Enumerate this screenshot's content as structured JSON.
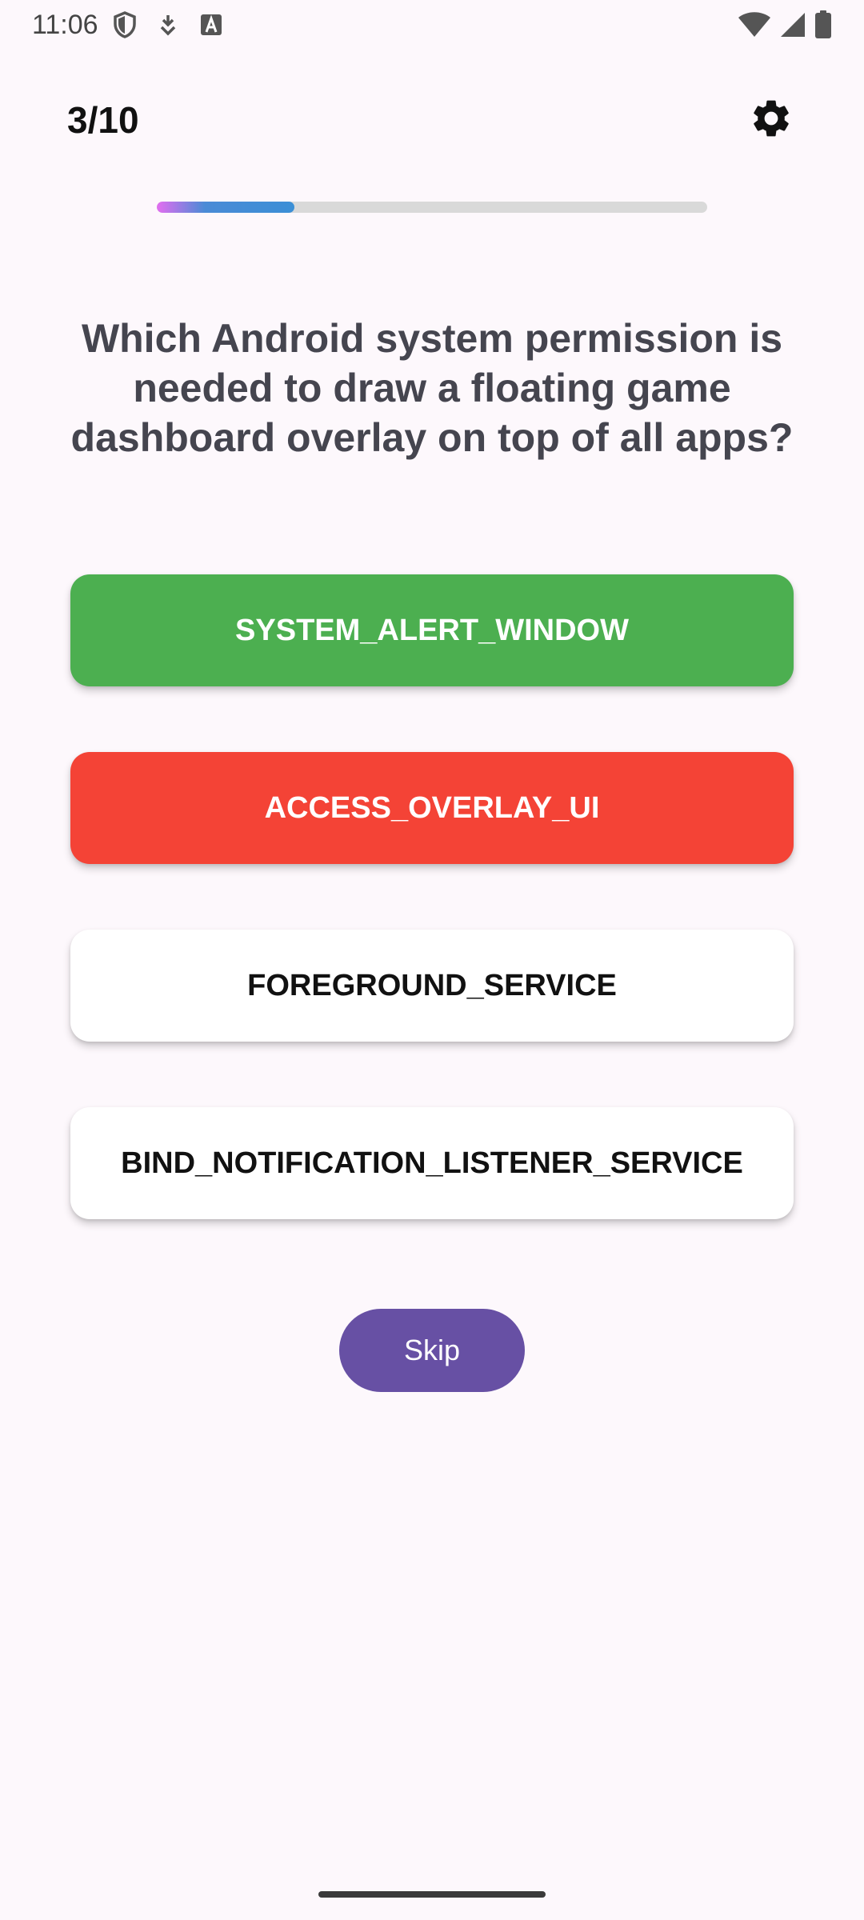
{
  "status_bar": {
    "time": "11:06",
    "left_icons": [
      "shield-icon",
      "download-icon",
      "font-icon"
    ],
    "right_icons": [
      "wifi-icon",
      "signal-icon",
      "battery-icon"
    ]
  },
  "header": {
    "progress_text": "3/10",
    "settings_icon": "gear-icon"
  },
  "progress": {
    "fraction": 0.25
  },
  "question": {
    "text": "Which Android system permission is needed to draw a floating game dashboard overlay on top of all apps?"
  },
  "answers": [
    {
      "label": "SYSTEM_ALERT_WINDOW",
      "state": "correct"
    },
    {
      "label": "ACCESS_OVERLAY_UI",
      "state": "wrong"
    },
    {
      "label": "FOREGROUND_SERVICE",
      "state": "neutral"
    },
    {
      "label": "BIND_NOTIFICATION_LISTENER_SERVICE",
      "state": "neutral"
    }
  ],
  "skip_button": {
    "label": "Skip"
  },
  "colors": {
    "correct": "#4caf50",
    "wrong": "#f44336",
    "skip": "#6750a4",
    "background": "#fdf8fc"
  }
}
